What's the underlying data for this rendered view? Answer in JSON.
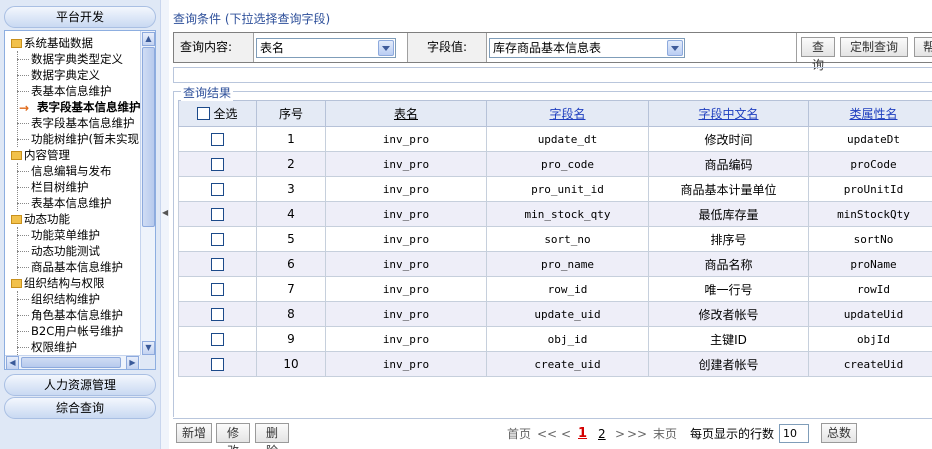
{
  "sidebar": {
    "header_platform": "平台开发",
    "header_hr": "人力资源管理",
    "header_query": "综合查询",
    "tree": {
      "g1": "系统基础数据",
      "g1_items": [
        "数据字典类型定义",
        "数据字典定义",
        "表基本信息维护",
        "表字段基本信息维护",
        "表字段基本信息维护",
        "功能树维护(暂未实现)"
      ],
      "g2": "内容管理",
      "g2_items": [
        "信息编辑与发布",
        "栏目树维护",
        "表基本信息维护"
      ],
      "g3": "动态功能",
      "g3_items": [
        "功能菜单维护",
        "动态功能测试",
        "商品基本信息维护"
      ],
      "g4": "组织结构与权限",
      "g4_items": [
        "组织结构维护",
        "角色基本信息维护",
        "B2C用户帐号维护",
        "权限维护"
      ]
    }
  },
  "condition": {
    "title": "查询条件 (下拉选择查询字段)",
    "content_label": "查询内容:",
    "content_value": "表名",
    "field_label": "字段值:",
    "field_value": "库存商品基本信息表",
    "query_button": "查询",
    "custom_query_button": "定制查询",
    "help_button": "帮"
  },
  "results": {
    "title": "查询结果",
    "select_all": "全选",
    "columns": [
      "序号",
      "表名",
      "字段名",
      "字段中文名",
      "类属性名"
    ],
    "rows": [
      {
        "no": "1",
        "table": "inv_pro",
        "field": "update_dt",
        "cn": "修改时间",
        "attr": "updateDt"
      },
      {
        "no": "2",
        "table": "inv_pro",
        "field": "pro_code",
        "cn": "商品编码",
        "attr": "proCode"
      },
      {
        "no": "3",
        "table": "inv_pro",
        "field": "pro_unit_id",
        "cn": "商品基本计量单位",
        "attr": "proUnitId"
      },
      {
        "no": "4",
        "table": "inv_pro",
        "field": "min_stock_qty",
        "cn": "最低库存量",
        "attr": "minStockQty"
      },
      {
        "no": "5",
        "table": "inv_pro",
        "field": "sort_no",
        "cn": "排序号",
        "attr": "sortNo"
      },
      {
        "no": "6",
        "table": "inv_pro",
        "field": "pro_name",
        "cn": "商品名称",
        "attr": "proName"
      },
      {
        "no": "7",
        "table": "inv_pro",
        "field": "row_id",
        "cn": "唯一行号",
        "attr": "rowId"
      },
      {
        "no": "8",
        "table": "inv_pro",
        "field": "update_uid",
        "cn": "修改者帐号",
        "attr": "updateUid"
      },
      {
        "no": "9",
        "table": "inv_pro",
        "field": "obj_id",
        "cn": "主键ID",
        "attr": "objId"
      },
      {
        "no": "10",
        "table": "inv_pro",
        "field": "create_uid",
        "cn": "创建者帐号",
        "attr": "createUid"
      }
    ]
  },
  "footer": {
    "add": "新增",
    "edit": "修改",
    "delete": "删除",
    "first": "首页",
    "prev_fast": "<<",
    "prev": "<",
    "page1": "1",
    "page2": "2",
    "next": ">",
    "next_fast": ">>",
    "last": "末页",
    "rows_label": "每页显示的行数",
    "rows_value": "10",
    "total": "总数"
  },
  "colors": {
    "title_blue": "#2d4f9a",
    "link_blue": "#1f3fbf",
    "current_page_red": "#d40000",
    "alt_row": "#eeeef8"
  }
}
